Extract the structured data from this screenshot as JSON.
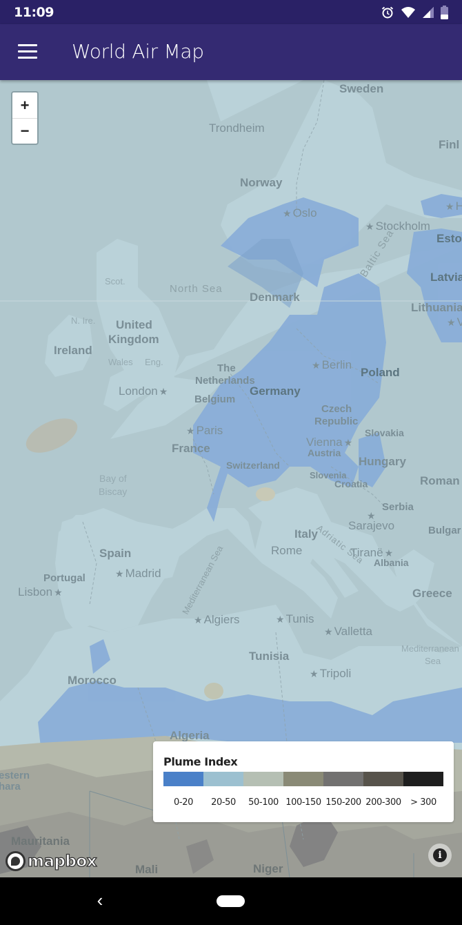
{
  "status_bar": {
    "time": "11:09",
    "icons": [
      "alarm-icon",
      "wifi-icon",
      "cell-signal-icon",
      "battery-icon"
    ]
  },
  "app_bar": {
    "menu_icon": "hamburger-menu-icon",
    "title": "World Air Map"
  },
  "map": {
    "zoom_in_label": "+",
    "zoom_out_label": "−",
    "labels": {
      "sweden": "Sweden",
      "trondheim": "Trondheim",
      "finland": "Finl",
      "norway": "Norway",
      "oslo": "Oslo",
      "stockholm": "Stockholm",
      "helsinki": "H",
      "estonia": "Esto",
      "latvia": "Latvia",
      "lithuania": "Lithuania",
      "vilnius": "V",
      "baltic_sea": "Baltic Sea",
      "scot": "Scot.",
      "north_sea": "North Sea",
      "denmark": "Denmark",
      "n_ire": "N. Ire.",
      "united": "United",
      "kingdom": "Kingdom",
      "ireland": "Ireland",
      "wales": "Wales",
      "eng": "Eng.",
      "london": "London",
      "the": "The",
      "netherlands": "Netherlands",
      "belgium": "Belgium",
      "germany": "Germany",
      "berlin": "Berlin",
      "poland": "Poland",
      "czech": "Czech",
      "republic": "Republic",
      "slovakia": "Slovakia",
      "paris": "Paris",
      "france": "France",
      "vienna": "Vienna",
      "austria": "Austria",
      "hungary": "Hungary",
      "romania": "Roman",
      "switzerland": "Switzerland",
      "slovenia": "Slovenia",
      "croatia": "Croatia",
      "bay_of": "Bay of",
      "biscay": "Biscay",
      "serbia": "Serbia",
      "sarajevo": "Sarajevo",
      "bulgaria": "Bulgar",
      "italy": "Italy",
      "adriatic_sea": "Adriatic Sea",
      "rome": "Rome",
      "tirane": "Tiranë",
      "albania": "Albania",
      "spain": "Spain",
      "madrid": "Madrid",
      "portugal": "Portugal",
      "lisbon": "Lisbon",
      "mediterranean_sea": "Mediterranean Sea",
      "greece": "Greece",
      "algiers": "Algiers",
      "tunis": "Tunis",
      "valletta": "Valletta",
      "mediterranean_sea_2a": "Mediterranean",
      "mediterranean_sea_2b": "Sea",
      "tunisia": "Tunisia",
      "tripoli": "Tripoli",
      "morocco": "Morocco",
      "algeria": "Algeria",
      "western": "estern",
      "sahara": "hara",
      "mauritania": "Mauritania",
      "mali": "Mali",
      "niger": "Niger"
    },
    "attribution_logo": "mapbox",
    "info_label": "i"
  },
  "legend": {
    "title": "Plume Index",
    "items": [
      {
        "label": "0-20",
        "color": "#4a80c8"
      },
      {
        "label": "20-50",
        "color": "#9cc0d0"
      },
      {
        "label": "50-100",
        "color": "#b5bfb3"
      },
      {
        "label": "100-150",
        "color": "#8a8a76"
      },
      {
        "label": "150-200",
        "color": "#727170"
      },
      {
        "label": "200-300",
        "color": "#57534b"
      },
      {
        "label": "> 300",
        "color": "#1e1e1e"
      }
    ]
  },
  "nav_bar": {
    "back_label": "‹"
  }
}
